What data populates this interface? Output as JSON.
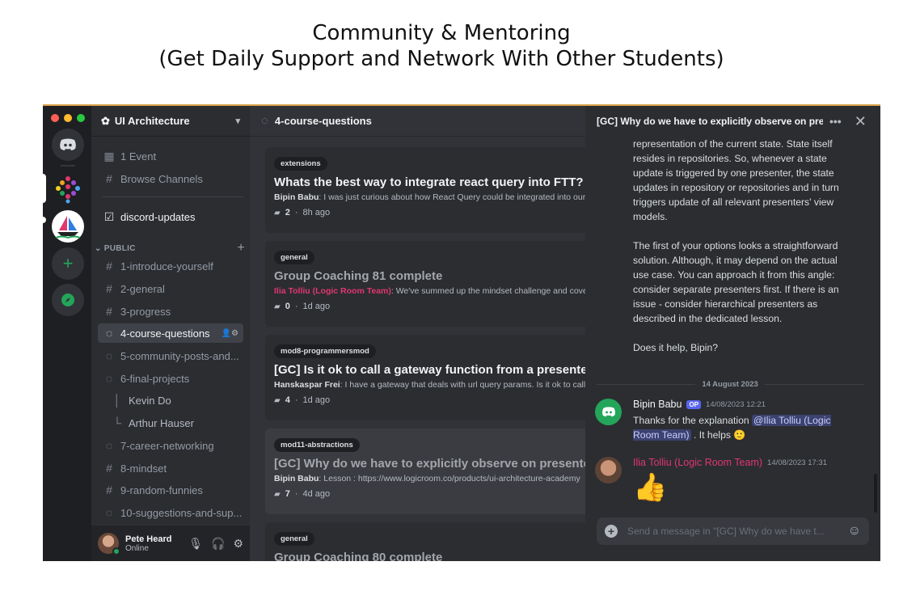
{
  "heading": {
    "line1": "Community & Mentoring",
    "line2": "(Get Daily Support and Network With Other Students)"
  },
  "colors": {
    "app_bg": "#313338",
    "rail_bg": "#1e1f22",
    "sidebar_bg": "#2b2d31",
    "online": "#23a55a",
    "staff_name": "#e0376e",
    "op_badge": "#5865f2"
  },
  "servers": [
    "discord-icon",
    "logic-room-icon",
    "sailboat-icon",
    "add-server-icon",
    "explore-icon"
  ],
  "sidebar": {
    "server_name": "UI Architecture",
    "event": "1 Event",
    "browse": "Browse Channels",
    "updates": "discord-updates",
    "section": "PUBLIC",
    "channels": [
      {
        "label": "1-introduce-yourself",
        "icon": "hash-icon"
      },
      {
        "label": "2-general",
        "icon": "hash-icon"
      },
      {
        "label": "3-progress",
        "icon": "hash-icon"
      },
      {
        "label": "4-course-questions",
        "icon": "forum-icon"
      },
      {
        "label": "5-community-posts-and...",
        "icon": "forum-icon"
      },
      {
        "label": "6-final-projects",
        "icon": "forum-icon"
      },
      {
        "label": "Kevin Do",
        "icon": "thread-icon"
      },
      {
        "label": "Arthur Hauser",
        "icon": "thread-icon"
      },
      {
        "label": "7-career-networking",
        "icon": "forum-icon"
      },
      {
        "label": "8-mindset",
        "icon": "hash-icon"
      },
      {
        "label": "9-random-funnies",
        "icon": "hash-icon"
      },
      {
        "label": "10-suggestions-and-sup...",
        "icon": "forum-icon"
      }
    ]
  },
  "user": {
    "name": "Pete Heard",
    "status": "Online"
  },
  "forum": {
    "channel": "4-course-questions",
    "posts": [
      {
        "tag": "extensions",
        "title": "Whats the best way to integrate react query into FTT?",
        "author": "Bipin Babu",
        "preview": " I was just curious about how React Query could be integrated into our",
        "count": "2",
        "age": "8h ago"
      },
      {
        "tag": "general",
        "title": "Group Coaching 81 complete",
        "author": "Ilia Tolliu (Logic Room Team)",
        "preview": " We've summed up the mindset challenge and covered",
        "count": "0",
        "age": "1d ago"
      },
      {
        "tag": "mod8-programmersmod",
        "title": "[GC] Is it ok to call a gateway function from a presenter",
        "author": "Hanskaspar Frei",
        "preview": " I have a gateway that deals with url query params. Is it ok to call",
        "count": "4",
        "age": "1d ago"
      },
      {
        "tag": "mod11-abstractions",
        "title": "[GC] Why do we have to explicitly observe on presenter",
        "author": "Bipin Babu",
        "preview": " Lesson : https://www.logicroom.co/products/ui-architecture-academy",
        "count": "7",
        "age": "4d ago"
      },
      {
        "tag": "general",
        "title": "Group Coaching 80 complete"
      }
    ]
  },
  "thread": {
    "title": "[GC] Why do we have to explicitly observe on presenter",
    "paragraph1": "representation of the current state. State itself resides in repositories. So, whenever a state update is triggered by one presenter, the state updates in repository or repositories and in turn triggers update of all relevant presenters' view models.",
    "paragraph2": "The first of your options looks a straightforward solution. Although, it may depend on the actual use case. You can approach it from this angle: consider separate presenters first. If there is an issue - consider hierarchical presenters as described in the dedicated lesson.",
    "paragraph3": "Does it help, Bipin?",
    "date_divider": "14 August 2023",
    "msg1": {
      "author": "Bipin Babu",
      "badge": "OP",
      "time": "14/08/2023 12:21",
      "text_before": "Thanks for the explanation ",
      "mention": "@Ilia Tolliu (Logic Room Team)",
      "text_after": " . It helps 🙂"
    },
    "msg2": {
      "author": "Ilia Tolliu (Logic Room Team)",
      "time": "14/08/2023 17:31",
      "reaction": "👍"
    },
    "composer_placeholder": "Send a message in \"[GC] Why do we have t..."
  }
}
